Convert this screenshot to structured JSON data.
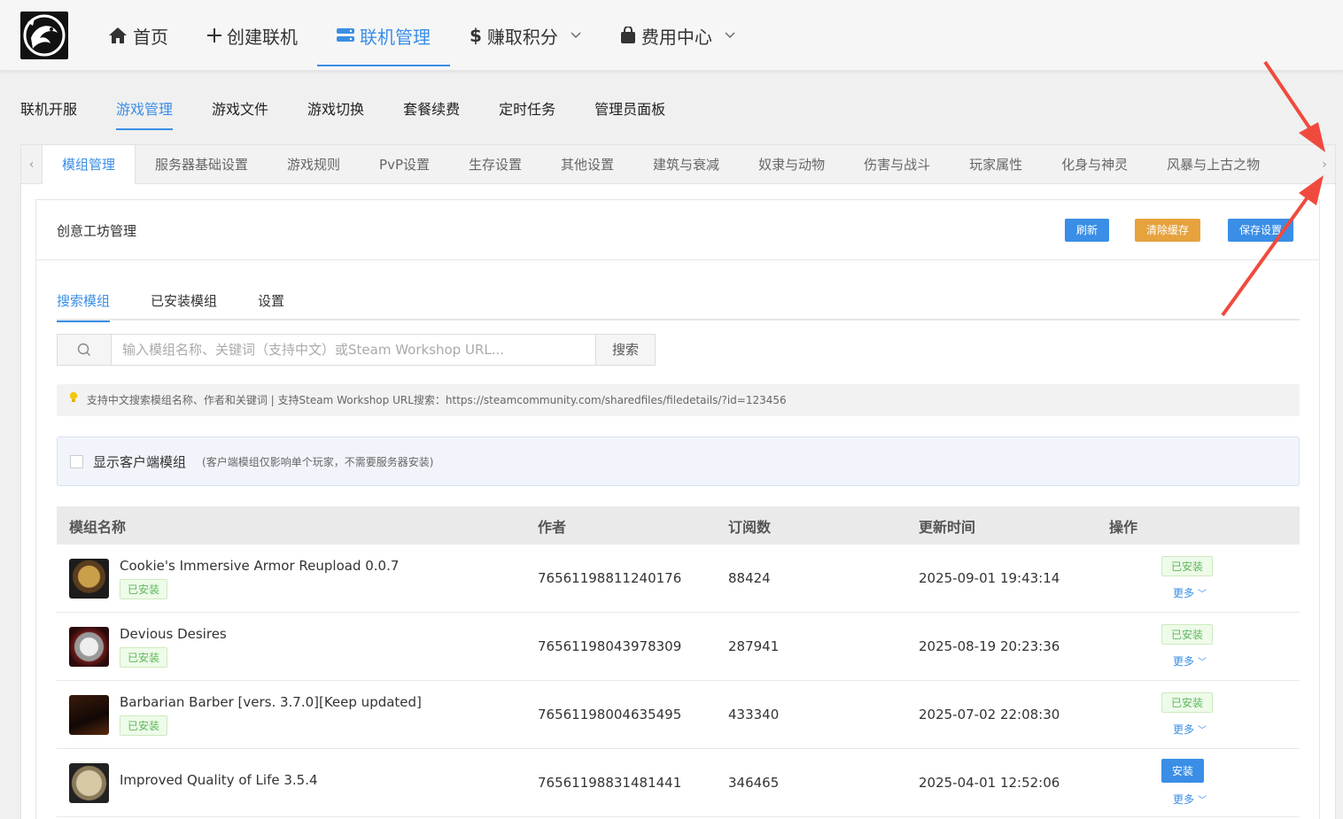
{
  "topnav": {
    "items": [
      {
        "label": "首页",
        "icon": "home-icon"
      },
      {
        "label": "创建联机",
        "icon": "plus-icon"
      },
      {
        "label": "联机管理",
        "icon": "server-icon",
        "active": true
      },
      {
        "label": "赚取积分",
        "icon": "dollar-icon",
        "dropdown": true
      },
      {
        "label": "费用中心",
        "icon": "bag-icon",
        "dropdown": true
      }
    ]
  },
  "subnav": {
    "items": [
      "联机开服",
      "游戏管理",
      "游戏文件",
      "游戏切换",
      "套餐续费",
      "定时任务",
      "管理员面板"
    ],
    "active": "游戏管理"
  },
  "tabs": {
    "items": [
      "模组管理",
      "服务器基础设置",
      "游戏规则",
      "PvP设置",
      "生存设置",
      "其他设置",
      "建筑与衰减",
      "奴隶与动物",
      "伤害与战斗",
      "玩家属性",
      "化身与神灵",
      "风暴与上古之物"
    ],
    "active": "模组管理",
    "left_arrow": "‹",
    "right_arrow": "›"
  },
  "panel": {
    "title": "创意工坊管理",
    "refresh_label": "刷新",
    "clear_cache_label": "清除缓存",
    "save_label": "保存设置"
  },
  "inner_tabs": {
    "items": [
      "搜索模组",
      "已安装模组",
      "设置"
    ],
    "active": "搜索模组"
  },
  "search": {
    "placeholder": "输入模组名称、关键词（支持中文）或Steam Workshop URL...",
    "button_label": "搜索"
  },
  "tip": {
    "text": "支持中文搜索模组名称、作者和关键词 | 支持Steam Workshop URL搜索：https://steamcommunity.com/sharedfiles/filedetails/?id=123456"
  },
  "client_mods": {
    "label": "显示客户端模组",
    "note": "(客户端模组仅影响单个玩家，不需要服务器安装)",
    "checked": false
  },
  "table": {
    "headers": [
      "模组名称",
      "作者",
      "订阅数",
      "更新时间",
      "操作"
    ],
    "rows": [
      {
        "name": "Cookie's Immersive Armor Reupload 0.0.7",
        "installed_tag": "已安装",
        "author": "76561198811240176",
        "subs": "88424",
        "updated": "2025-09-01 19:43:14",
        "op_label": "已安装",
        "op_installed": true,
        "more": "更多"
      },
      {
        "name": "Devious Desires",
        "installed_tag": "已安装",
        "author": "76561198043978309",
        "subs": "287941",
        "updated": "2025-08-19 20:23:36",
        "op_label": "已安装",
        "op_installed": true,
        "more": "更多"
      },
      {
        "name": "Barbarian Barber [vers. 3.7.0][Keep updated]",
        "installed_tag": "已安装",
        "author": "76561198004635495",
        "subs": "433340",
        "updated": "2025-07-02 22:08:30",
        "op_label": "已安装",
        "op_installed": true,
        "more": "更多"
      },
      {
        "name": "Improved Quality of Life 3.5.4",
        "installed_tag": "",
        "author": "76561198831481441",
        "subs": "346465",
        "updated": "2025-04-01 12:52:06",
        "op_label": "安装",
        "op_installed": false,
        "more": "更多"
      }
    ]
  },
  "colors": {
    "accent": "#3a8ee6",
    "warning": "#e6a23c",
    "success": "#5cb85c",
    "annotation_arrow": "#f04a3e"
  }
}
